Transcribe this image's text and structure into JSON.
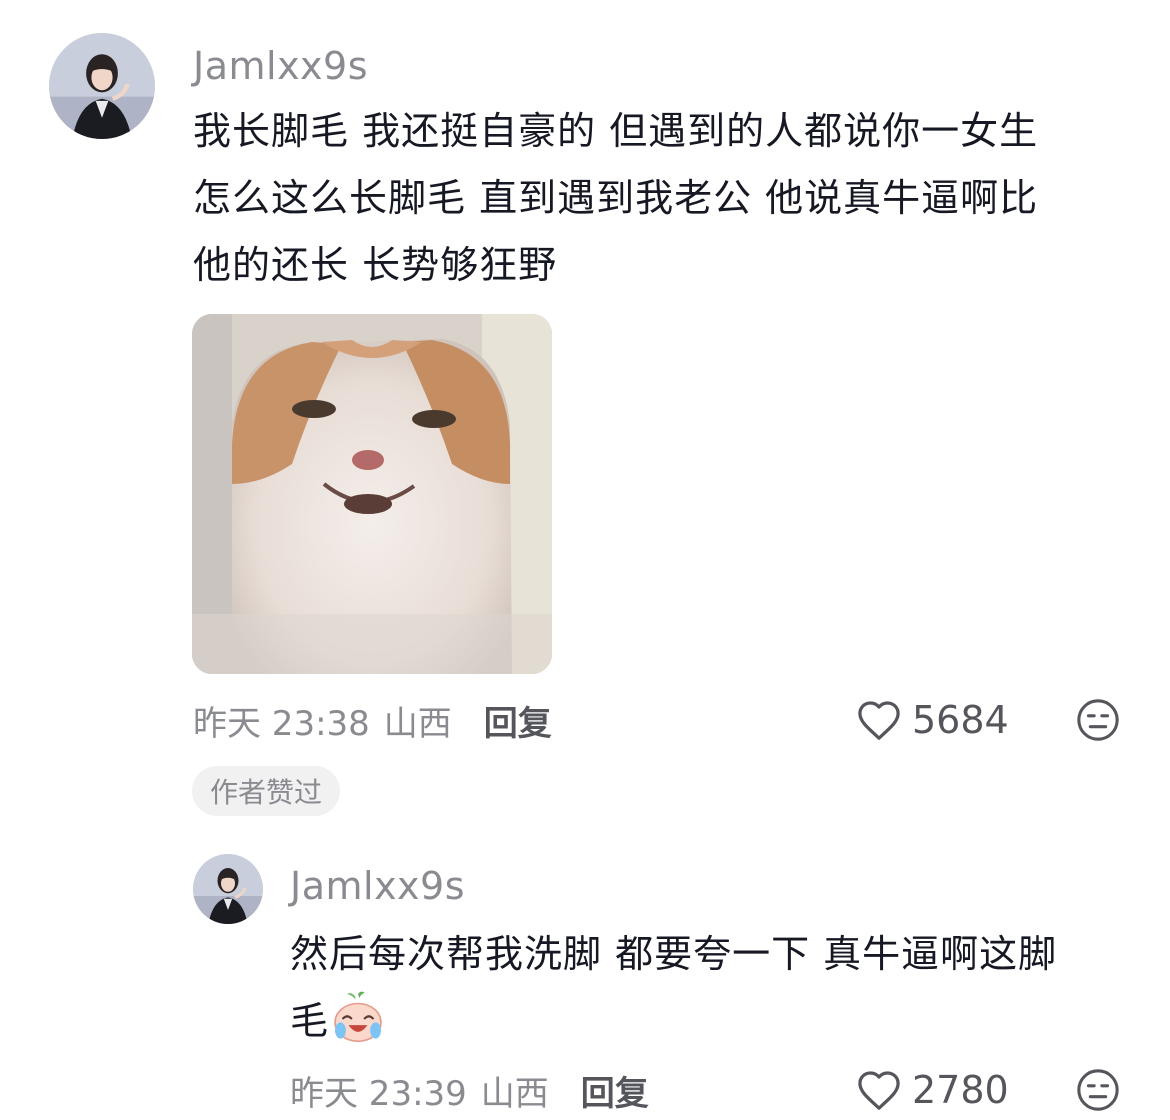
{
  "comment": {
    "username": "Jamlxx9s",
    "text_lines": [
      "我长脚毛 我还挺自豪的 但遇到的人都说你一女生",
      "怎么这么长脚毛 直到遇到我老公 他说真牛逼啊比",
      "他的还长 长势够狂野"
    ],
    "time": "昨天 23:38",
    "location": "山西",
    "reply_label": "回复",
    "like_count": "5684",
    "author_badge": "作者赞过"
  },
  "reply": {
    "username": "Jamlxx9s",
    "text_lines": [
      "然后每次帮我洗脚 都要夸一下 真牛逼啊这脚",
      "毛"
    ],
    "emoji": "laughing-tears-emoji",
    "time": "昨天 23:39",
    "location": "山西",
    "reply_label": "回复",
    "like_count": "2780"
  },
  "icons": {
    "like": "heart-outline-icon",
    "dislike": "meh-face-icon"
  },
  "colors": {
    "text_primary": "#161823",
    "text_secondary": "#8a8b91",
    "badge_bg": "#f1f1f2"
  }
}
